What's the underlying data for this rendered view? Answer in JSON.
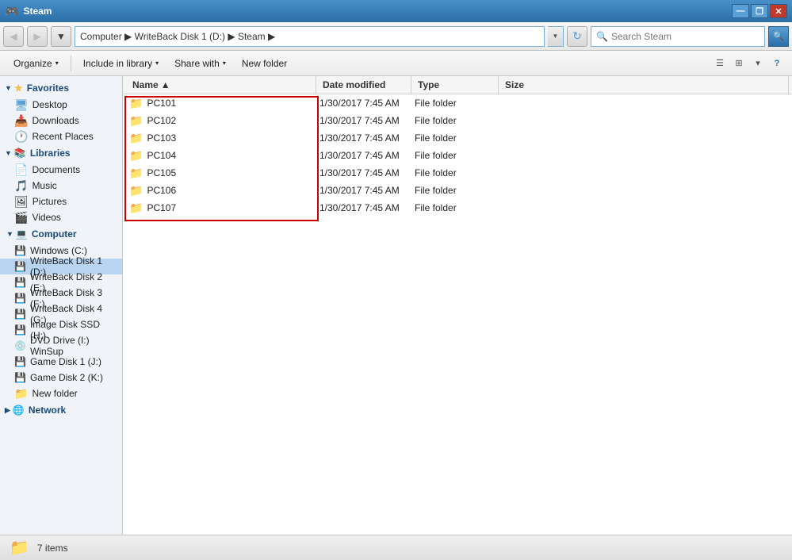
{
  "titleBar": {
    "icon": "🎮",
    "title": "Steam",
    "minimizeLabel": "—",
    "restoreLabel": "❐",
    "closeLabel": "✕"
  },
  "navBar": {
    "backLabel": "◀",
    "forwardLabel": "▶",
    "downLabel": "▼",
    "addressPath": "Computer ▶ WriteBack Disk 1 (D:) ▶ Steam ▶",
    "dropdownLabel": "▼",
    "refreshLabel": "↻",
    "searchPlaceholder": "Search Steam",
    "searchGoLabel": "🔍"
  },
  "toolbar": {
    "organizeLabel": "Organize",
    "includeLabel": "Include in library",
    "shareWithLabel": "Share with",
    "newFolderLabel": "New folder",
    "arrowLabel": "▾"
  },
  "sidebar": {
    "favoritesLabel": "Favorites",
    "desktopLabel": "Desktop",
    "downloadsLabel": "Downloads",
    "recentPlacesLabel": "Recent Places",
    "librariesLabel": "Libraries",
    "documentsLabel": "Documents",
    "musicLabel": "Music",
    "picturesLabel": "Pictures",
    "videosLabel": "Videos",
    "computerLabel": "Computer",
    "windowsCLabel": "Windows (C:)",
    "writeback1Label": "WriteBack Disk 1 (D:)",
    "writeback2Label": "WriteBack Disk 2 (E:)",
    "writeback3Label": "WriteBack Disk 3 (F:)",
    "writeback4Label": "WriteBack Disk 4 (G:)",
    "imageDiskLabel": "Image Disk SSD (H:)",
    "dvdDriveLabel": "DVD Drive (I:) WinSup",
    "gameDisk1Label": "Game Disk 1 (J:)",
    "gameDisk2Label": "Game Disk 2 (K:)",
    "newFolderSidebarLabel": "New folder",
    "networkLabel": "Network"
  },
  "contentHeader": {
    "nameLabel": "Name",
    "sortIndicator": "▲",
    "dateModifiedLabel": "Date modified",
    "typeLabel": "Type",
    "sizeLabel": "Size"
  },
  "files": [
    {
      "name": "PC101",
      "dateModified": "1/30/2017 7:45 AM",
      "type": "File folder",
      "size": ""
    },
    {
      "name": "PC102",
      "dateModified": "1/30/2017 7:45 AM",
      "type": "File folder",
      "size": ""
    },
    {
      "name": "PC103",
      "dateModified": "1/30/2017 7:45 AM",
      "type": "File folder",
      "size": ""
    },
    {
      "name": "PC104",
      "dateModified": "1/30/2017 7:45 AM",
      "type": "File folder",
      "size": ""
    },
    {
      "name": "PC105",
      "dateModified": "1/30/2017 7:45 AM",
      "type": "File folder",
      "size": ""
    },
    {
      "name": "PC106",
      "dateModified": "1/30/2017 7:45 AM",
      "type": "File folder",
      "size": ""
    },
    {
      "name": "PC107",
      "dateModified": "1/30/2017 7:45 AM",
      "type": "File folder",
      "size": ""
    }
  ],
  "statusBar": {
    "itemCount": "7 items"
  }
}
